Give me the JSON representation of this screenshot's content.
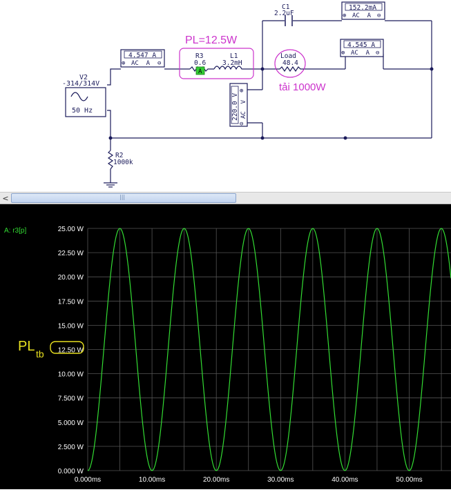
{
  "schematic": {
    "source": {
      "name": "V2",
      "value": "-314/314V",
      "freq": "50 Hz"
    },
    "ammeter_in": {
      "reading": "4.547 A",
      "mode": "AC  A"
    },
    "pl_annotation": "PL=12.5W",
    "r3": {
      "name": "R3",
      "value": "0.6"
    },
    "l1": {
      "name": "L1",
      "value": "3.2mH"
    },
    "probe_label": "A",
    "c1": {
      "name": "C1",
      "value": "2.2uF"
    },
    "ammeter_c": {
      "reading": "152.2mA",
      "mode": "AC  A"
    },
    "load": {
      "name": "Load",
      "value": "48.4"
    },
    "load_annotation": "tải 1000W",
    "ammeter_load": {
      "reading": "4.545 A",
      "mode": "AC  A"
    },
    "voltmeter": {
      "reading": "220.0 V",
      "mode": "AC  V"
    },
    "r2": {
      "name": "R2",
      "value": "1000k"
    },
    "colors": {
      "annotation": "#cc33cc",
      "wire": "#1a1a5a",
      "probe": "#33cc33"
    }
  },
  "scrollbar": {
    "left_arrow": "<",
    "thumb_grip": "|||"
  },
  "scope": {
    "trace_label": "A: r3[p]",
    "pl_label": "PL",
    "pl_subscript": "tb",
    "highlighted_tick": "12.50 W",
    "trace_color": "#33dd33",
    "grid_color": "#555555",
    "label_color": "#ffffff",
    "annotation_color": "#e8e020"
  },
  "chart_data": {
    "type": "line",
    "title": "",
    "xlabel": "",
    "ylabel": "",
    "series": [
      {
        "name": "A: r3[p]",
        "x_ms": [
          0,
          5,
          10,
          15,
          20,
          25,
          30,
          35,
          40,
          45,
          50,
          55
        ],
        "values_W": [
          0,
          25.0,
          0,
          25.0,
          0,
          25.0,
          0,
          25.0,
          0,
          25.0,
          0,
          25.0
        ]
      }
    ],
    "xlim_ms": [
      0,
      56.5
    ],
    "ylim_W": [
      0,
      25
    ],
    "x_ticks": [
      "0.000ms",
      "10.00ms",
      "20.00ms",
      "30.00ms",
      "40.00ms",
      "50.00ms"
    ],
    "y_ticks": [
      "0.000 W",
      "2.500 W",
      "5.000 W",
      "7.500 W",
      "10.00 W",
      "12.50 W",
      "15.00 W",
      "17.50 W",
      "20.00 W",
      "22.50 W",
      "25.00 W"
    ],
    "grid": true
  }
}
